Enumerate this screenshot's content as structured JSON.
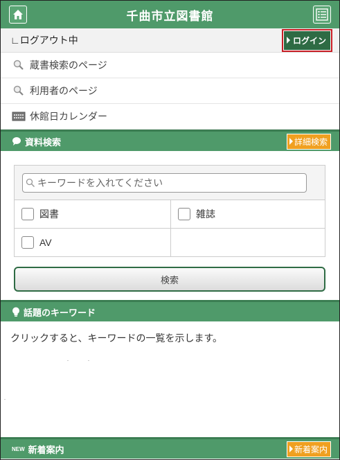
{
  "header": {
    "title": "千曲市立図書館",
    "home_icon": "home-icon",
    "menu_icon": "menu-list-icon"
  },
  "login": {
    "status": "∟ログアウト中",
    "button_label": "ログイン"
  },
  "nav": [
    {
      "label": "蔵書検索のページ",
      "icon": "search-icon"
    },
    {
      "label": "利用者のページ",
      "icon": "search-icon"
    },
    {
      "label": "休館日カレンダー",
      "icon": "calendar-icon"
    }
  ],
  "search_section": {
    "title": "資料検索",
    "detail_button": "詳細検索",
    "keyword_placeholder": "キーワードを入れてください",
    "checkboxes": [
      "図書",
      "雑誌",
      "AV"
    ],
    "search_button": "検索"
  },
  "topic_section": {
    "title": "話題のキーワード",
    "description": "クリックすると、キーワードの一覧を示します。"
  },
  "new_section": {
    "badge": "NEW",
    "title": "新着案内",
    "button": "新着案内"
  },
  "colors": {
    "header_green": "#4f9a6a",
    "login_red": "#c81d25",
    "accent_orange": "#f0a020"
  }
}
